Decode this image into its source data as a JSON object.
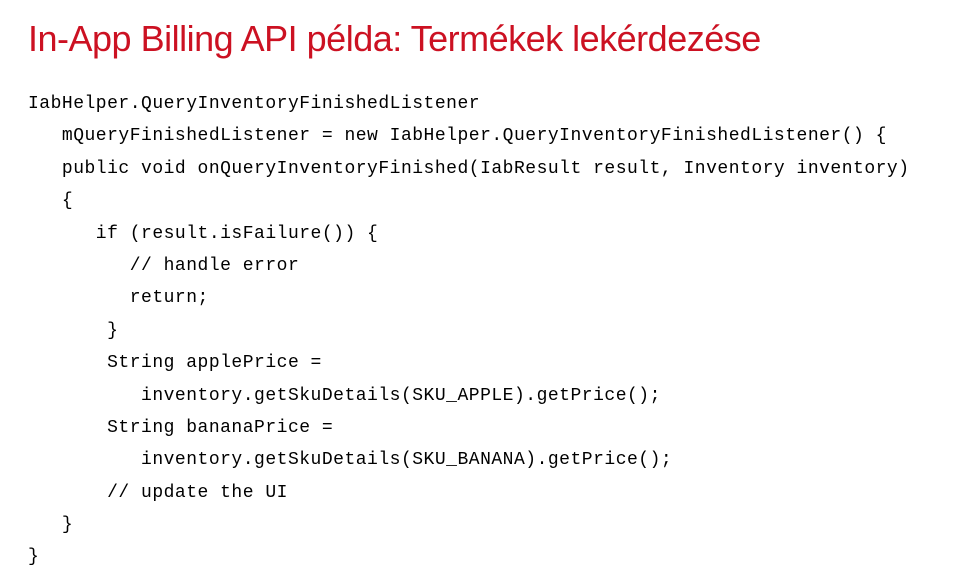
{
  "title": "In-App Billing API példa: Termékek lekérdezése",
  "code": {
    "l01": "IabHelper.QueryInventoryFinishedListener",
    "l02": "   mQueryFinishedListener = new IabHelper.QueryInventoryFinishedListener() {",
    "l03": "   public void onQueryInventoryFinished(IabResult result, Inventory inventory)",
    "l04": "   {",
    "l05": "      if (result.isFailure()) {",
    "l06": "         // handle error",
    "l07": "         return;",
    "l08": "       }",
    "l09": "       String applePrice =",
    "l10": "          inventory.getSkuDetails(SKU_APPLE).getPrice();",
    "l11": "       String bananaPrice =",
    "l12": "          inventory.getSkuDetails(SKU_BANANA).getPrice();",
    "l13": "       // update the UI",
    "l14": "   }",
    "l15": "}"
  }
}
